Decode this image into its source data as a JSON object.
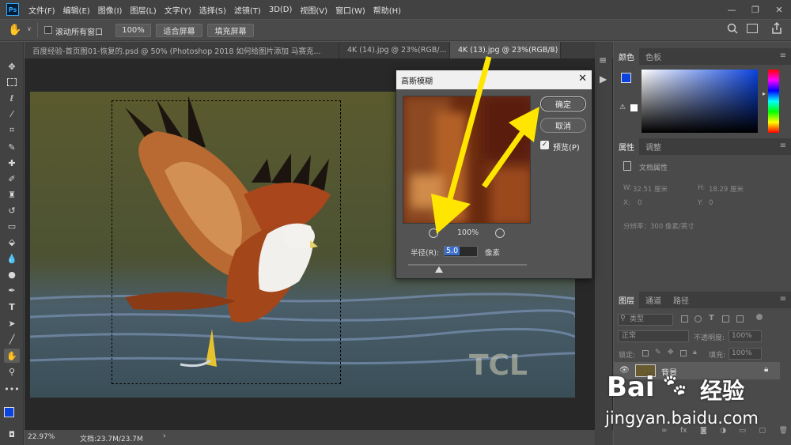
{
  "menu": {
    "logo": "Ps",
    "items": [
      "文件(F)",
      "编辑(E)",
      "图像(I)",
      "图层(L)",
      "文字(Y)",
      "选择(S)",
      "滤镜(T)",
      "3D(D)",
      "视图(V)",
      "窗口(W)",
      "帮助(H)"
    ],
    "minimize": "—",
    "restore": "❐",
    "close": "✕"
  },
  "options": {
    "scroll_all_label": "滚动所有窗口",
    "zoom_value": "100%",
    "fit_screen": "适合屏幕",
    "fill_screen": "填充屏幕"
  },
  "tabs": [
    {
      "label": "百度经验-首页图01-恢复的.psd @ 50% (Photoshop 2018  如何给图片添加 马赛克..."
    },
    {
      "label": "4K (14).jpg @ 23%(RGB/..."
    },
    {
      "label": "4K (13).jpg @ 23%(RGB/8)",
      "close": "×"
    }
  ],
  "status": {
    "zoom": "22.97%",
    "doc": "文档:23.7M/23.7M",
    "arrow": "›"
  },
  "color_panel": {
    "tab_color": "颜色",
    "tab_swatches": "色板",
    "fg_color": "#0a43e0"
  },
  "properties_panel": {
    "tab_properties": "属性",
    "tab_adjust": "调整",
    "doc_props": "文档属性",
    "w_label": "W:",
    "w_value": "32.51 厘米",
    "h_label": "H:",
    "h_value": "18.29 厘米",
    "x_label": "X:",
    "x_value": "0",
    "y_label": "Y:",
    "y_value": "0",
    "resolution": "分辨率：300 像素/英寸"
  },
  "layers_panel": {
    "tab_layers": "图层",
    "tab_channels": "通道",
    "tab_paths": "路径",
    "kind": "类型",
    "blend": "正常",
    "opacity_label": "不透明度:",
    "opacity_value": "100%",
    "lock_label": "锁定:",
    "fill_label": "填充:",
    "fill_value": "100%",
    "layer_name": "背景"
  },
  "dialog": {
    "title": "高斯模糊",
    "ok": "确定",
    "cancel": "取消",
    "preview_label": "预览(P)",
    "zoom_value": "100%",
    "radius_label": "半径(R):",
    "radius_value": "5.0",
    "radius_unit": "像素"
  },
  "photo": {
    "logo_text": "TCL"
  },
  "watermark": {
    "brand": "Bai",
    "brand2": "经验",
    "url": "jingyan.baidu.com"
  },
  "colors": {
    "annotation_arrow": "#ffe600",
    "accent_blue": "#0a43e0"
  }
}
